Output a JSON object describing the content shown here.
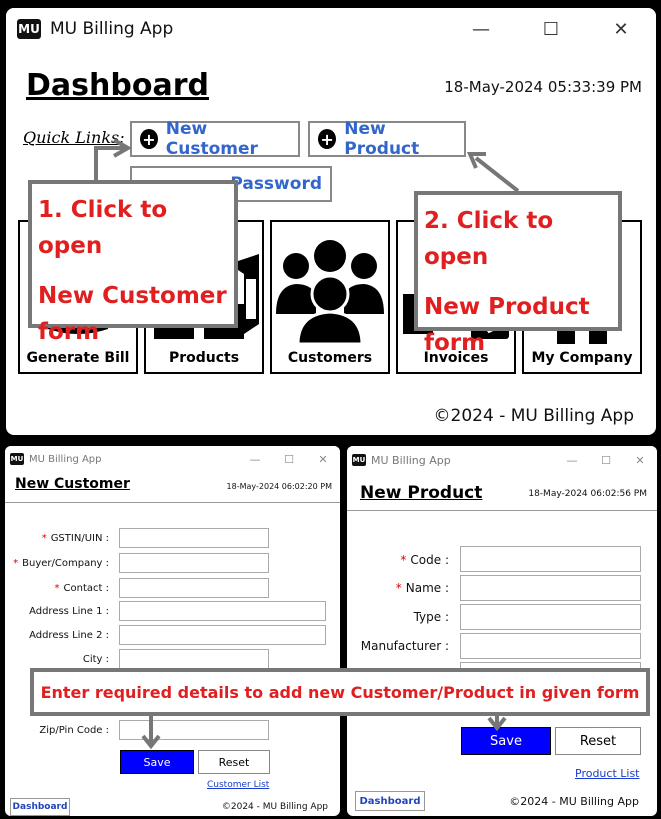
{
  "main_window": {
    "title": "MU Billing App",
    "logo_text": "MU",
    "controls": {
      "minimize": "—",
      "maximize": "☐",
      "close": "✕"
    },
    "heading": "Dashboard",
    "datetime": "18-May-2024 05:33:39 PM",
    "quick_links_label": "Quick Links:",
    "quick_links": [
      {
        "label": "New Customer",
        "icon": "plus-circle-icon"
      },
      {
        "label": "New Product",
        "icon": "plus-circle-icon"
      },
      {
        "label": "Password",
        "icon": "key-icon"
      }
    ],
    "tiles": [
      {
        "label": "Generate Bill",
        "icon": "bill-icon"
      },
      {
        "label": "Products",
        "icon": "boxes-icon"
      },
      {
        "label": "Customers",
        "icon": "people-icon"
      },
      {
        "label": "Invoices",
        "icon": "invoice-icon"
      },
      {
        "label": "My Company",
        "icon": "company-icon"
      }
    ],
    "footer": "©2024 - MU Billing App"
  },
  "callouts": {
    "customer": [
      "1. Click to open",
      "New Customer",
      "form"
    ],
    "product": [
      "2. Click to open",
      "New Product",
      "form"
    ],
    "banner": "Enter required details to add new Customer/Product in given form"
  },
  "customer_window": {
    "title": "MU Billing App",
    "logo_text": "MU",
    "heading": "New Customer",
    "datetime": "18-May-2024 06:02:20 PM",
    "fields": [
      {
        "label": "GSTIN/UIN :",
        "required": true
      },
      {
        "label": "Buyer/Company :",
        "required": true
      },
      {
        "label": "Contact :",
        "required": true
      },
      {
        "label": "Address Line 1 :",
        "required": false
      },
      {
        "label": "Address Line 2 :",
        "required": false
      },
      {
        "label": "City :",
        "required": false
      },
      {
        "label": "Zip/Pin Code :",
        "required": false
      }
    ],
    "save_label": "Save",
    "reset_label": "Reset",
    "list_link": "Customer List",
    "dashboard_tab": "Dashboard",
    "footer": "©2024 - MU Billing App"
  },
  "product_window": {
    "title": "MU Billing App",
    "logo_text": "MU",
    "heading": "New Product",
    "datetime": "18-May-2024 06:02:56 PM",
    "fields": [
      {
        "label": "Code :",
        "required": true
      },
      {
        "label": "Name :",
        "required": true
      },
      {
        "label": "Type :",
        "required": false
      },
      {
        "label": "Manufacturer :",
        "required": false
      }
    ],
    "save_label": "Save",
    "reset_label": "Reset",
    "list_link": "Product List",
    "dashboard_tab": "Dashboard",
    "footer": "©2024 - MU Billing App"
  },
  "colors": {
    "link_blue": "#3366cc",
    "save_blue": "#0000ff",
    "callout_red": "#e02020",
    "required_red": "#dd0000"
  }
}
